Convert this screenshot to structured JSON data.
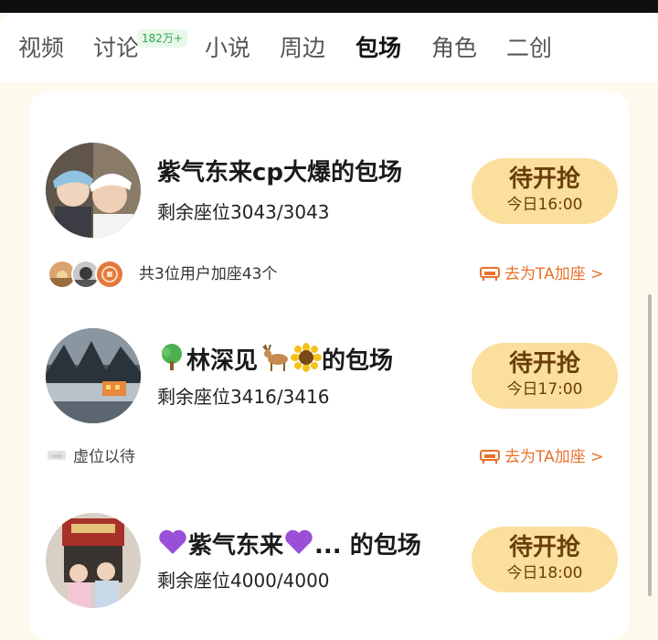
{
  "tabs": [
    {
      "label": "视频",
      "active": false
    },
    {
      "label": "讨论",
      "active": false,
      "badge": "182万+"
    },
    {
      "label": "小说",
      "active": false
    },
    {
      "label": "周边",
      "active": false
    },
    {
      "label": "包场",
      "active": true
    },
    {
      "label": "角色",
      "active": false
    },
    {
      "label": "二创",
      "active": false
    }
  ],
  "sessions": [
    {
      "title": "紫气东来cp大爆的包场",
      "seats": "剩余座位3043/3043",
      "button_label": "待开抢",
      "button_time": "今日16:00",
      "joined_text": "共3位用户加座43个",
      "link_text": "去为TA加座 >"
    },
    {
      "title_text": "林深见",
      "title_suffix": "的包场",
      "seats": "剩余座位3416/3416",
      "button_label": "待开抢",
      "button_time": "今日17:00",
      "joined_text": "虚位以待",
      "link_text": "去为TA加座 >"
    },
    {
      "title_text": "紫气东来",
      "title_suffix": "... 的包场",
      "seats": "剩余座位4000/4000",
      "button_label": "待开抢",
      "button_time": "今日18:00"
    }
  ],
  "colors": {
    "accent_button": "#fbdf9c",
    "button_text": "#6a3e0c",
    "link_orange": "#e8702a",
    "badge_green": "#2fa84f",
    "page_bg": "#fdf9ec"
  },
  "icons": [
    "tree-emoji-icon",
    "deer-emoji-icon",
    "sunflower-emoji-icon",
    "purple-heart-icon",
    "sofa-icon"
  ]
}
